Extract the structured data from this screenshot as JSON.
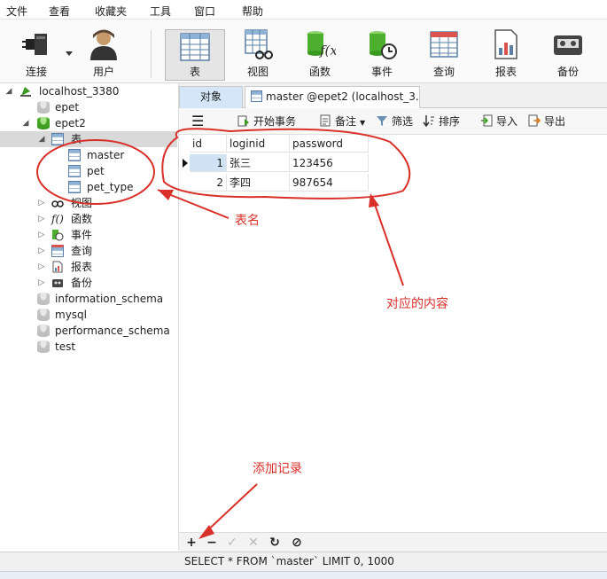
{
  "menu": [
    "文件",
    "查看",
    "收藏夹",
    "工具",
    "窗口",
    "帮助"
  ],
  "toolbar": [
    {
      "label": "连接",
      "icon": "plug-icon"
    },
    {
      "label": "用户",
      "icon": "user-icon"
    },
    {
      "label": "表",
      "icon": "table-icon"
    },
    {
      "label": "视图",
      "icon": "view-icon"
    },
    {
      "label": "函数",
      "icon": "function-icon"
    },
    {
      "label": "事件",
      "icon": "event-icon"
    },
    {
      "label": "查询",
      "icon": "query-icon"
    },
    {
      "label": "报表",
      "icon": "report-icon"
    },
    {
      "label": "备份",
      "icon": "backup-icon"
    }
  ],
  "tree": {
    "connection": "localhost_3380",
    "databases_top": [
      "epet",
      "epet2"
    ],
    "tables_node": "表",
    "tables": [
      "master",
      "pet",
      "pet_type"
    ],
    "objects": [
      "视图",
      "函数",
      "事件",
      "查询",
      "报表",
      "备份"
    ],
    "databases_bottom": [
      "information_schema",
      "mysql",
      "performance_schema",
      "test"
    ]
  },
  "tabs": {
    "objects": "对象",
    "active": "master @epet2 (localhost_3..."
  },
  "subtoolbar": {
    "menu_icon": "hamburger-icon",
    "begin_transaction": "开始事务",
    "note": "备注",
    "filter": "筛选",
    "sort": "排序",
    "import": "导入",
    "export": "导出"
  },
  "grid": {
    "columns": [
      "id",
      "loginid",
      "password"
    ],
    "rows": [
      [
        "1",
        "张三",
        "123456"
      ],
      [
        "2",
        "李四",
        "987654"
      ]
    ]
  },
  "nav_buttons": [
    "+",
    "−",
    "✓",
    "✕",
    "↻",
    "⊘"
  ],
  "status": "SELECT * FROM `master` LIMIT 0, 1000",
  "annotations": {
    "table_names": "表名",
    "content": "对应的内容",
    "add_record": "添加记录"
  },
  "colors": {
    "annotation": "#d9302a",
    "selected_tab": "#d4e6f7",
    "db_green": "#4caf2e"
  }
}
